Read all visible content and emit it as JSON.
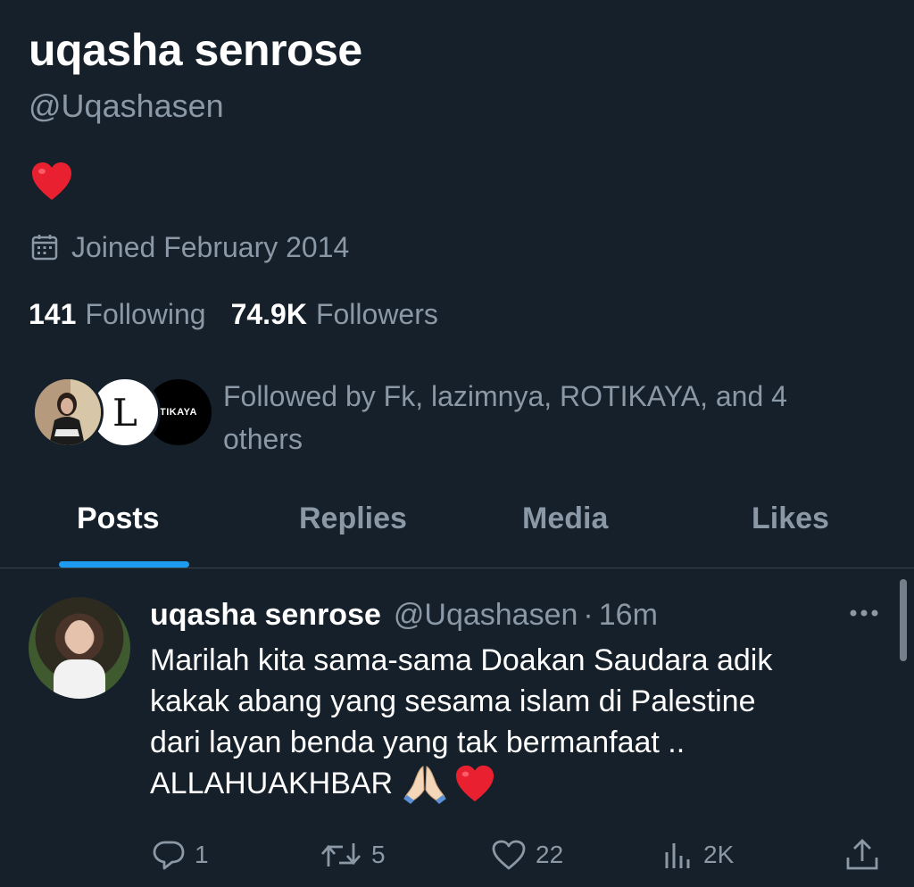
{
  "profile": {
    "display_name": "uqasha senrose",
    "handle": "@Uqashasen",
    "bio_emoji": "red-heart",
    "joined": "Joined February 2014",
    "following_count": "141",
    "following_label": "Following",
    "followers_count": "74.9K",
    "followers_label": "Followers",
    "followed_by": "Followed by Fk, lazimnya, ROTIKAYA, and 4 others",
    "avatar2_glyph": "L",
    "avatar3_glyph": "TIKAYA"
  },
  "tabs": [
    {
      "label": "Posts",
      "active": true
    },
    {
      "label": "Replies",
      "active": false
    },
    {
      "label": "Media",
      "active": false
    },
    {
      "label": "Likes",
      "active": false
    }
  ],
  "post": {
    "name": "uqasha senrose",
    "handle": "@Uqashasen",
    "separator": "·",
    "time": "16m",
    "text_line1": "Marilah kita sama-sama Doakan Saudara adik",
    "text_line2": "kakak abang yang sesama islam di Palestine",
    "text_line3": "dari layan benda yang tak bermanfaat ..",
    "text_line4": "ALLAHUAKHBAR",
    "text_emojis": [
      "folded-hands",
      "red-heart"
    ],
    "replies": "1",
    "reposts": "5",
    "likes": "22",
    "views": "2K"
  },
  "colors": {
    "background": "#15202b",
    "secondary_text": "#8b98a5",
    "accent": "#1d9bf0",
    "heart": "#e0245e"
  }
}
